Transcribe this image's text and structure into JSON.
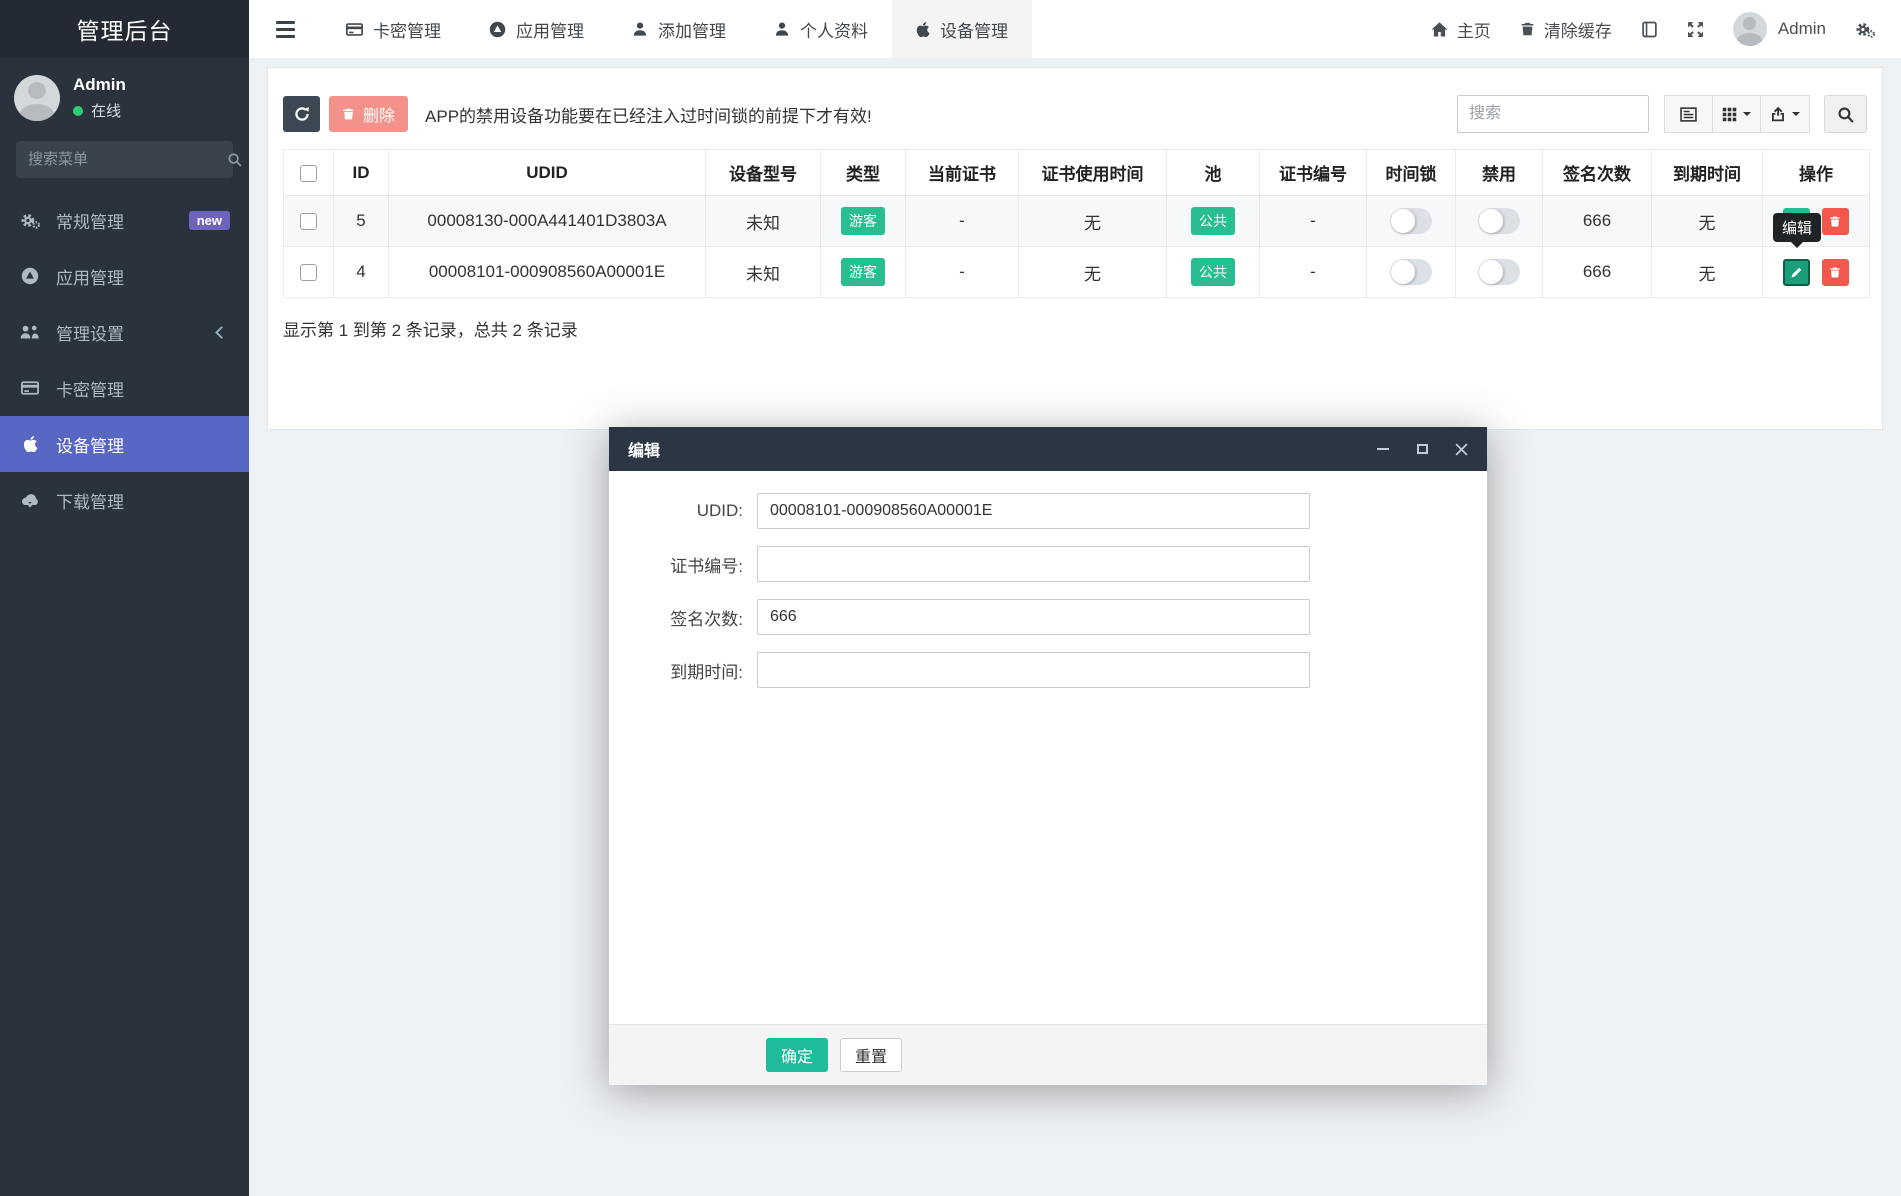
{
  "app": {
    "title": "管理后台"
  },
  "sidebar": {
    "user": {
      "name": "Admin",
      "status": "在线"
    },
    "search_placeholder": "搜索菜单",
    "items": [
      {
        "label": "常规管理",
        "badge": "new"
      },
      {
        "label": "应用管理"
      },
      {
        "label": "管理设置"
      },
      {
        "label": "卡密管理"
      },
      {
        "label": "设备管理"
      },
      {
        "label": "下载管理"
      }
    ]
  },
  "navbar": {
    "tabs": [
      {
        "label": "卡密管理"
      },
      {
        "label": "应用管理"
      },
      {
        "label": "添加管理"
      },
      {
        "label": "个人资料"
      },
      {
        "label": "设备管理"
      }
    ],
    "home_label": "主页",
    "clear_cache_label": "清除缓存",
    "user_name": "Admin"
  },
  "toolbar": {
    "delete_label": "删除",
    "notice": "APP的禁用设备功能要在已经注入过时间锁的前提下才有效!",
    "search_placeholder": "搜索"
  },
  "table": {
    "columns": [
      "ID",
      "UDID",
      "设备型号",
      "类型",
      "当前证书",
      "证书使用时间",
      "池",
      "证书编号",
      "时间锁",
      "禁用",
      "签名次数",
      "到期时间",
      "操作"
    ],
    "rows": [
      {
        "id": "5",
        "udid": "00008130-000A441401D3803A",
        "model": "未知",
        "type": "游客",
        "cert": "-",
        "cert_time": "无",
        "pool": "公共",
        "cert_no": "-",
        "sign_count": "666",
        "expire": "无"
      },
      {
        "id": "4",
        "udid": "00008101-000908560A00001E",
        "model": "未知",
        "type": "游客",
        "cert": "-",
        "cert_time": "无",
        "pool": "公共",
        "cert_no": "-",
        "sign_count": "666",
        "expire": "无"
      }
    ],
    "summary": "显示第 1 到第 2 条记录，总共 2 条记录"
  },
  "tooltip": {
    "label": "编辑"
  },
  "modal": {
    "title": "编辑",
    "fields": [
      {
        "label": "UDID:",
        "value": "00008101-000908560A00001E"
      },
      {
        "label": "证书编号:",
        "value": ""
      },
      {
        "label": "签名次数:",
        "value": "666"
      },
      {
        "label": "到期时间:",
        "value": ""
      }
    ],
    "ok_label": "确定",
    "reset_label": "重置"
  },
  "colors": {
    "sidebar_bg": "#2a323d",
    "sidebar_active": "#5867c3",
    "badge_new": "#6e63bd",
    "teal_badge": "#2abd92",
    "green_button": "#1fbc9c",
    "red_button": "#f2574c",
    "salmon_button": "#f2928a",
    "dark_button": "#3d4653",
    "modal_header": "#2b3642",
    "online_dot": "#2ecc71"
  }
}
